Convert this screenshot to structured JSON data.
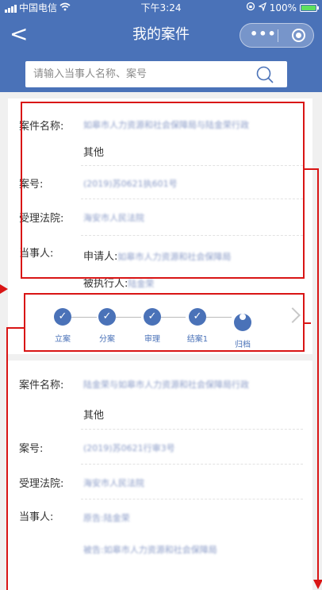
{
  "status_bar": {
    "carrier": "中国电信",
    "time": "下午3:24",
    "battery": "100%"
  },
  "nav": {
    "back": "<",
    "title": "我的案件",
    "menu": "•••"
  },
  "search": {
    "placeholder": "请输入当事人名称、案号"
  },
  "cases": [
    {
      "name_label": "案件名称:",
      "name_value": "如皋市人力资源和社会保障局与陆金荣行政",
      "name_type": "其他",
      "number_label": "案号:",
      "number_value": "(2019)苏0621执601号",
      "court_label": "受理法院:",
      "court_value": "海安市人民法院",
      "party_label": "当事人:",
      "applicant_prefix": "申请人:",
      "applicant_value": "如皋市人力资源和社会保障局",
      "respondent_prefix": "被执行人:",
      "respondent_value": "陆金荣"
    },
    {
      "name_label": "案件名称:",
      "name_value": "陆金荣与如皋市人力资源和社会保障局行政",
      "name_type": "其他",
      "number_label": "案号:",
      "number_value": "(2019)苏0621行审3号",
      "court_label": "受理法院:",
      "court_value": "海安市人民法院",
      "party_label": "当事人:",
      "party_line1": "原告:陆金荣",
      "party_line2": "被告:如皋市人力资源和社会保障局"
    }
  ],
  "steps": [
    {
      "label": "立案",
      "state": "done",
      "mark": "✓"
    },
    {
      "label": "分案",
      "state": "done",
      "mark": "✓"
    },
    {
      "label": "审理",
      "state": "done",
      "mark": "✓"
    },
    {
      "label": "结案1",
      "state": "done",
      "mark": "✓"
    },
    {
      "label": "归档",
      "state": "current",
      "mark": ""
    }
  ],
  "colors": {
    "primary": "#4a72b8",
    "highlight": "#d91515",
    "battery": "#5ee05e"
  }
}
